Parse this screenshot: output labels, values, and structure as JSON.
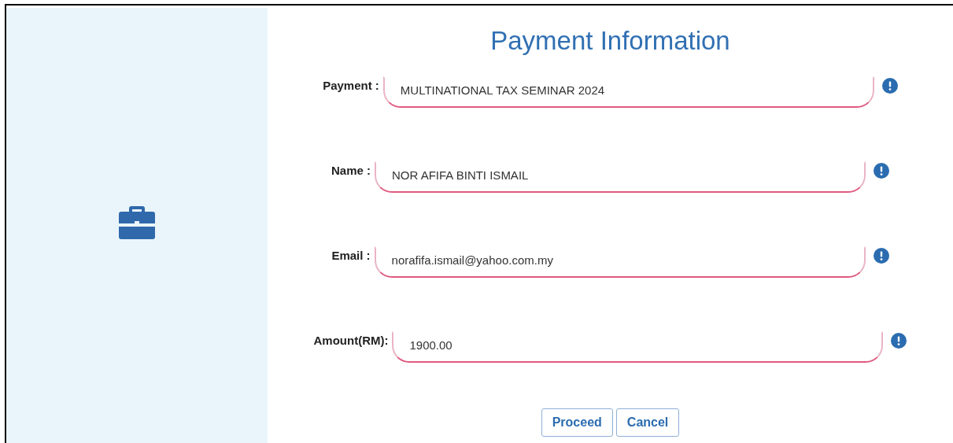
{
  "title": "Payment Information",
  "fields": [
    {
      "label": "Payment :",
      "value": "MULTINATIONAL TAX SEMINAR 2024"
    },
    {
      "label": "Name :",
      "value": "NOR AFIFA BINTI ISMAIL"
    },
    {
      "label": "Email :",
      "value": "norafifa.ismail@yahoo.com.my"
    },
    {
      "label": "Amount(RM):",
      "value": "1900.00"
    }
  ],
  "buttons": [
    "Proceed",
    "Cancel"
  ]
}
